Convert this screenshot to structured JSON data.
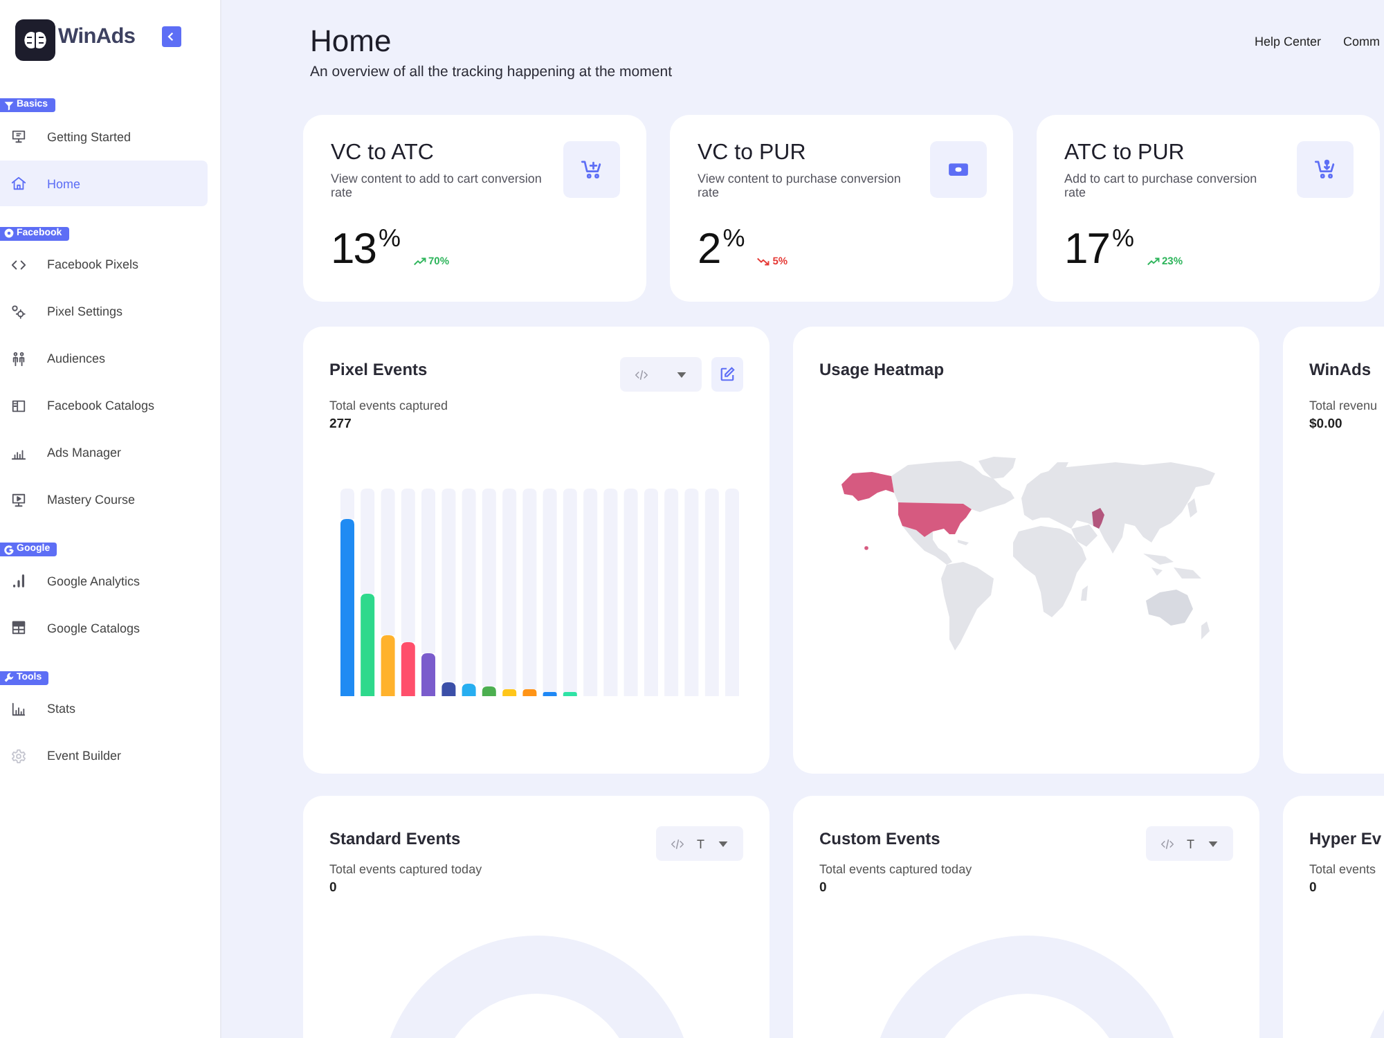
{
  "sidebar": {
    "logo": "WinAds",
    "sections": [
      {
        "label": "Basics",
        "items": [
          {
            "label": "Getting Started",
            "selected": false
          },
          {
            "label": "Home",
            "selected": true
          }
        ]
      },
      {
        "label": "Facebook",
        "items": [
          {
            "label": "Facebook Pixels",
            "selected": false
          },
          {
            "label": "Pixel Settings",
            "selected": false
          },
          {
            "label": "Audiences",
            "selected": false
          },
          {
            "label": "Facebook Catalogs",
            "selected": false
          },
          {
            "label": "Ads Manager",
            "selected": false
          },
          {
            "label": "Mastery Course",
            "selected": false
          }
        ]
      },
      {
        "label": "Google",
        "items": [
          {
            "label": "Google Analytics",
            "selected": false
          },
          {
            "label": "Google Catalogs",
            "selected": false
          }
        ]
      },
      {
        "label": "Tools",
        "items": [
          {
            "label": "Stats",
            "selected": false
          },
          {
            "label": "Event Builder",
            "selected": false
          }
        ]
      }
    ]
  },
  "header": {
    "title": "Home",
    "subtitle": "An overview of all the tracking happening at the moment",
    "links": [
      "Help Center",
      "Comm"
    ]
  },
  "stat_cards": [
    {
      "title": "VC to ATC",
      "description": "View content to add to cart conversion rate",
      "value": "13$^{%}$",
      "change": "70%",
      "rising": true
    },
    {
      "title": "VC to PUR",
      "description": "View content to purchase conversion rate",
      "value": "2$^{%}$",
      "change": "5%",
      "rising": false
    },
    {
      "title": "ATC to PUR",
      "description": "Add to cart to purchase conversion rate",
      "value": "17$^{%}$",
      "change": "23%",
      "rising": true
    }
  ],
  "panels": [
    {
      "kind": "bars",
      "title": "Pixel Events",
      "caption": "Total events captured",
      "total": "277",
      "dropdown": true,
      "edit_button": true
    },
    {
      "kind": "map",
      "title": "Usage Heatmap"
    },
    {
      "kind": "summary",
      "title": "WinAds",
      "caption": "Total revenu",
      "total": "$0.00"
    },
    {
      "kind": "ring",
      "title": "Standard Events",
      "caption": "Total events captured today",
      "total": "0",
      "dropdown": true,
      "dropdown_value": "T"
    },
    {
      "kind": "ring",
      "title": "Custom Events",
      "caption": "Total events captured today",
      "total": "0",
      "dropdown": true,
      "dropdown_value": "T"
    },
    {
      "kind": "ring",
      "title": "Hyper Ev",
      "caption": "Total events",
      "total": "0"
    }
  ]
}
